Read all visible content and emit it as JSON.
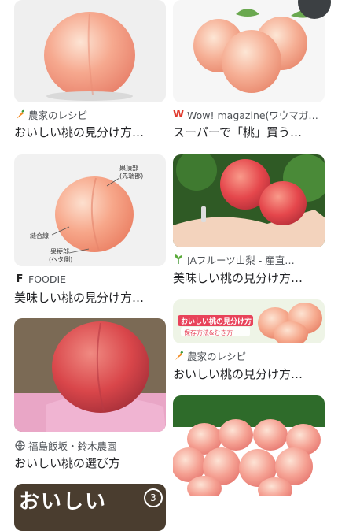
{
  "results": {
    "left": [
      {
        "source": "農家のレシピ",
        "title": "おいしい桃の見分け方…",
        "icon": "carrot-icon"
      },
      {
        "source": "FOODIE",
        "title": "美味しい桃の見分け方…",
        "icon": "foodie-f-icon",
        "labels": {
          "top": "果頂部",
          "top2": "(先端部)",
          "side": "縫合線",
          "bottom": "果梗部",
          "bottom2": "(ヘタ側)"
        }
      },
      {
        "source": "福島飯坂・鈴木農園",
        "title": "おいしい桃の選び方",
        "icon": "globe-icon"
      },
      {
        "overlay_text": "おいしい"
      }
    ],
    "right": [
      {
        "source": "Wow! magazine(ワウマガ…",
        "title": "スーパーで「桃」買う…",
        "icon": "wow-w-icon"
      },
      {
        "source": "JAフルーツ山梨 - 産直…",
        "title": "美味しい桃の見分け方…",
        "icon": "sprout-icon"
      },
      {
        "source": "農家のレシピ",
        "title": "おいしい桃の見分け方…",
        "icon": "carrot-icon",
        "banner1": "おいしい桃の見分け方",
        "banner2": "保存方法&むき方"
      },
      {
        "source": "",
        "title": ""
      }
    ]
  },
  "badge_count": "3",
  "colors": {
    "peach": "#f5a08a",
    "peach_light": "#fbd8c6",
    "bg_gray": "#f1f1f1",
    "source_text": "#4d5156"
  }
}
